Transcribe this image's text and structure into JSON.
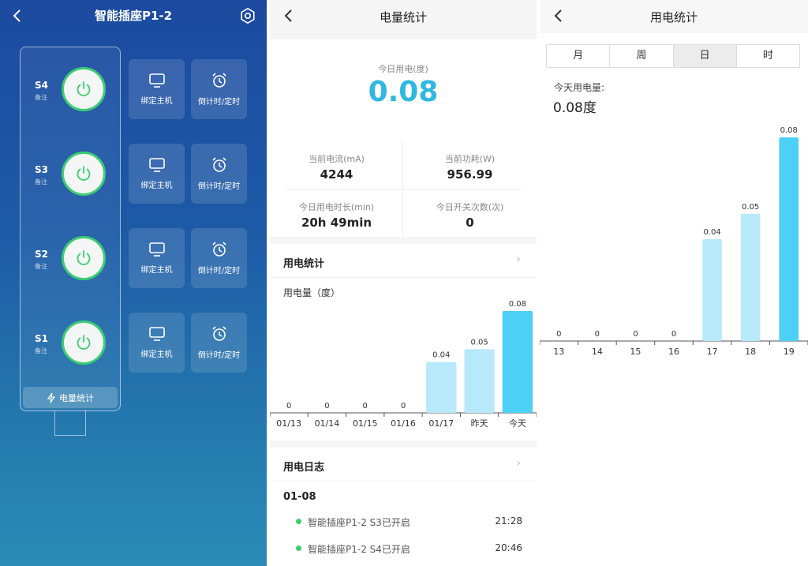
{
  "panel1": {
    "title": "智能插座P1-2",
    "sockets": [
      {
        "name": "S4",
        "note": "备注"
      },
      {
        "name": "S3",
        "note": "备注"
      },
      {
        "name": "S2",
        "note": "备注"
      },
      {
        "name": "S1",
        "note": "备注"
      }
    ],
    "bind_label": "绑定主机",
    "timer_label": "倒计时/定时",
    "stats_button": "电量统计",
    "icons": {
      "back": "chevron-left-icon",
      "settings": "gear-icon",
      "power": "power-icon",
      "monitor": "monitor-icon",
      "alarm": "alarm-clock-icon",
      "bolt": "lightning-icon"
    },
    "colors": {
      "power_ring": "#3ccd73"
    }
  },
  "panel2": {
    "title": "电量统计",
    "today_caption": "今日用电(度)",
    "today_value": "0.08",
    "stats": [
      {
        "label": "当前电流(mA)",
        "value": "4244"
      },
      {
        "label": "当前功耗(W)",
        "value": "956.99"
      },
      {
        "label": "今日用电时长(min)",
        "value": "20h 49min"
      },
      {
        "label": "今日开关次数(次)",
        "value": "0"
      }
    ],
    "usage_section": "用电统计",
    "log_section": "用电日志",
    "log_date": "01-08",
    "logs": [
      {
        "text": "智能插座P1-2 S3已开启",
        "time": "21:28"
      },
      {
        "text": "智能插座P1-2 S4已开启",
        "time": "20:46"
      }
    ],
    "chart_data": {
      "type": "bar",
      "title": "",
      "ylabel": "用电量（度）",
      "categories": [
        "01/13",
        "01/14",
        "01/15",
        "01/16",
        "01/17",
        "昨天",
        "今天"
      ],
      "values": [
        0,
        0,
        0,
        0,
        0.04,
        0.05,
        0.08
      ],
      "value_labels": [
        "0",
        "0",
        "0",
        "0",
        "0.04",
        "0.05",
        "0.08"
      ],
      "ylim": [
        0,
        0.08
      ],
      "grid": false,
      "colors": {
        "normal": "#b8e9fa",
        "highlight": "#4cd0f5"
      }
    }
  },
  "panel3": {
    "title": "用电统计",
    "tabs": [
      {
        "label": "月",
        "active": false
      },
      {
        "label": "周",
        "active": false
      },
      {
        "label": "日",
        "active": true
      },
      {
        "label": "时",
        "active": false
      }
    ],
    "today_label": "今天用电量:",
    "today_value": "0.08度",
    "chart_data": {
      "type": "bar",
      "title": "",
      "categories": [
        "13",
        "14",
        "15",
        "16",
        "17",
        "18",
        "19"
      ],
      "values": [
        0,
        0,
        0,
        0,
        0.04,
        0.05,
        0.08
      ],
      "value_labels": [
        "0",
        "0",
        "0",
        "0",
        "0.04",
        "0.05",
        "0.08"
      ],
      "ylim": [
        0,
        0.08
      ],
      "grid": false,
      "colors": {
        "normal": "#b8e9fa",
        "highlight": "#4cd0f5"
      }
    }
  }
}
